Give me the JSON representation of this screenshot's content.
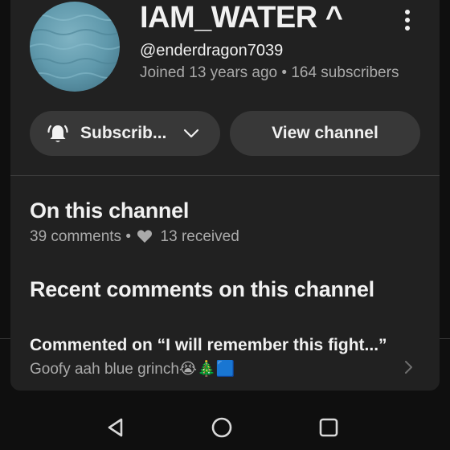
{
  "channel": {
    "name": "IAM_WATER ^",
    "handle": "@enderdragon7039",
    "meta": "Joined 13 years ago • 164 subscribers"
  },
  "actions": {
    "subscribe_label": "Subscrib...",
    "view_channel_label": "View channel"
  },
  "on_this_channel": {
    "title": "On this channel",
    "comments": "39 comments •",
    "received": "13 received"
  },
  "recent_comments": {
    "title": "Recent comments on this channel",
    "items": [
      {
        "commented_on": "Commented on “I will remember this fight...”",
        "text": "Goofy aah blue grinch😭🎄🟦"
      }
    ]
  },
  "icons": {
    "menu": "more-vert-icon",
    "bell": "notifications-active-icon",
    "dropdown": "chevron-down-icon",
    "heart": "heart-icon",
    "row_arrow": "chevron-right-icon",
    "nav_back": "back-triangle-icon",
    "nav_home": "home-circle-icon",
    "nav_recents": "recents-square-icon"
  },
  "colors": {
    "background": "#0f0f0f",
    "panel": "#212121",
    "button": "#383838",
    "text_primary": "#f1f1f1",
    "text_secondary": "#aaaaaa"
  }
}
